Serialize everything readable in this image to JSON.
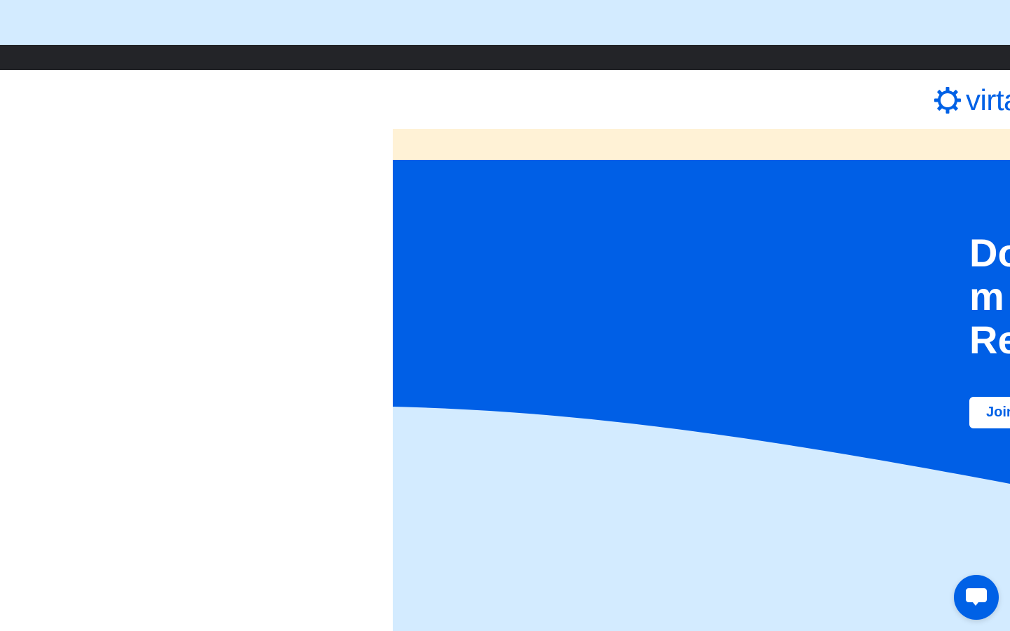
{
  "brand": {
    "name": "virta",
    "logo_icon": "sun-gear-icon",
    "color": "#0061e6"
  },
  "colors": {
    "top_band": "#d3ebff",
    "dark_bar": "#232428",
    "notice_band": "#fff2d6",
    "hero_blue": "#005fe6",
    "wave_light": "#d3ebff"
  },
  "hero": {
    "title_lines": [
      "Do",
      "m",
      "Re"
    ],
    "cta_label": "Join"
  },
  "chat": {
    "icon": "chat-bubble-icon"
  }
}
